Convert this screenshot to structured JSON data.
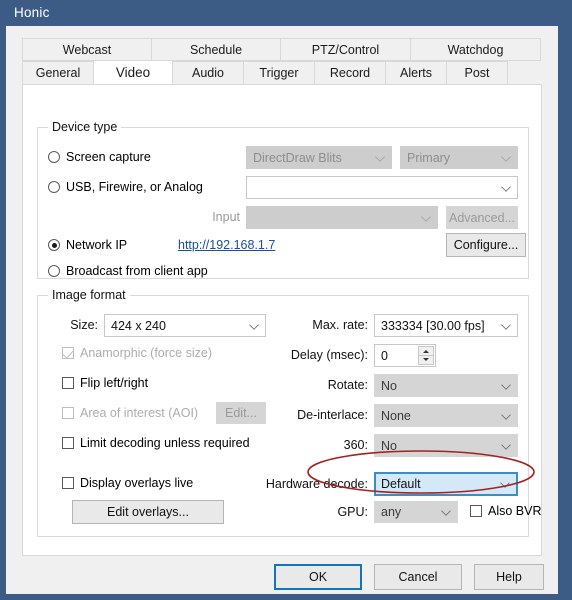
{
  "window": {
    "title": "Honic"
  },
  "tabs": {
    "row1": [
      {
        "label": "Webcast",
        "selected": false
      },
      {
        "label": "Schedule",
        "selected": false
      },
      {
        "label": "PTZ/Control",
        "selected": false
      },
      {
        "label": "Watchdog",
        "selected": false
      }
    ],
    "row2": [
      {
        "label": "General",
        "selected": false
      },
      {
        "label": "Video",
        "selected": true
      },
      {
        "label": "Audio",
        "selected": false
      },
      {
        "label": "Trigger",
        "selected": false
      },
      {
        "label": "Record",
        "selected": false
      },
      {
        "label": "Alerts",
        "selected": false
      },
      {
        "label": "Post",
        "selected": false
      }
    ]
  },
  "device_type": {
    "group_title": "Device type",
    "screen_capture": {
      "label": "Screen capture",
      "selected": false,
      "method_value": "DirectDraw Blits",
      "monitor_value": "Primary"
    },
    "usb": {
      "label": "USB, Firewire, or Analog",
      "selected": false,
      "device_value": ""
    },
    "input": {
      "label": "Input",
      "value": "",
      "advanced_button": "Advanced..."
    },
    "network_ip": {
      "label": "Network IP",
      "selected": true,
      "url": "http://192.168.1.7",
      "configure_button": "Configure..."
    },
    "broadcast": {
      "label": "Broadcast from client app",
      "selected": false
    }
  },
  "image_format": {
    "group_title": "Image format",
    "size": {
      "label": "Size:",
      "value": "424 x 240"
    },
    "anamorphic": {
      "label": "Anamorphic (force size)",
      "checked": true,
      "enabled": false
    },
    "flip": {
      "label": "Flip left/right",
      "checked": false
    },
    "aoi": {
      "label": "Area of interest (AOI)",
      "checked": false,
      "enabled": false,
      "edit_button": "Edit..."
    },
    "limit_decoding": {
      "label": "Limit decoding unless required",
      "checked": false
    },
    "display_overlays": {
      "label": "Display overlays live",
      "checked": false
    },
    "edit_overlays_button": "Edit overlays...",
    "max_rate": {
      "label": "Max. rate:",
      "value": "333334 [30.00 fps]"
    },
    "delay": {
      "label": "Delay (msec):",
      "value": "0"
    },
    "rotate": {
      "label": "Rotate:",
      "value": "No"
    },
    "deinterlace": {
      "label": "De-interlace:",
      "value": "None"
    },
    "threesixty": {
      "label": "360:",
      "value": "No"
    },
    "hardware_decode": {
      "label": "Hardware decode:",
      "value": "Default",
      "highlighted": true
    },
    "gpu": {
      "label": "GPU:",
      "value": "any"
    },
    "also_bvr": {
      "label": "Also BVR",
      "checked": false
    }
  },
  "footer": {
    "ok": "OK",
    "cancel": "Cancel",
    "help": "Help"
  },
  "annotation": {
    "shape": "ellipse",
    "color": "#a32121",
    "target": "hardware-decode-combo"
  },
  "colors": {
    "titlebar": "#3d5c85",
    "dialog": "#f0f0f0",
    "page": "#ffffff",
    "accent_focus": "#1275bc",
    "highlight_fill": "#d4e8f7",
    "link": "#1a4fa0",
    "annotation_red": "#a32121"
  }
}
